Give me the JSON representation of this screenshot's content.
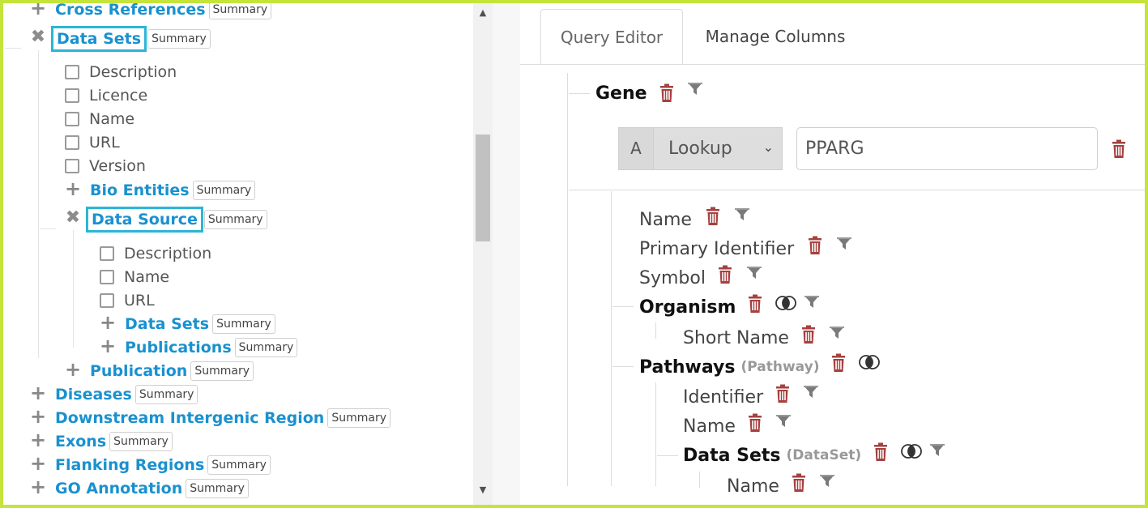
{
  "left_tree": {
    "summary_label": "Summary",
    "items": [
      {
        "label": "Cross References"
      },
      {
        "label": "Data Sets"
      },
      {
        "label": "Description"
      },
      {
        "label": "Licence"
      },
      {
        "label": "Name"
      },
      {
        "label": "URL"
      },
      {
        "label": "Version"
      },
      {
        "label": "Bio Entities"
      },
      {
        "label": "Data Source"
      },
      {
        "label": "Description"
      },
      {
        "label": "Name"
      },
      {
        "label": "URL"
      },
      {
        "label": "Data Sets"
      },
      {
        "label": "Publications"
      },
      {
        "label": "Publication"
      },
      {
        "label": "Diseases"
      },
      {
        "label": "Downstream Intergenic Region"
      },
      {
        "label": "Exons"
      },
      {
        "label": "Flanking Regions"
      },
      {
        "label": "GO Annotation"
      }
    ],
    "icons": {
      "expand": "plus-icon",
      "collapse": "close-icon",
      "checkbox": "checkbox-icon"
    }
  },
  "tabs": [
    {
      "label": "Query Editor",
      "active": true
    },
    {
      "label": "Manage Columns",
      "active": false
    }
  ],
  "query": {
    "root": "Gene",
    "constraint": {
      "code": "A",
      "operator": "Lookup",
      "value": "PPARG"
    },
    "fields": [
      {
        "label": "Name"
      },
      {
        "label": "Primary Identifier"
      },
      {
        "label": "Symbol"
      },
      {
        "label": "Organism"
      },
      {
        "label": "Short Name"
      },
      {
        "label": "Pathways",
        "type": "(Pathway)"
      },
      {
        "label": "Identifier"
      },
      {
        "label": "Name"
      },
      {
        "label": "Data Sets",
        "type": "(DataSet)"
      },
      {
        "label": "Name"
      }
    ]
  },
  "colors": {
    "accent": "#1a91cf",
    "highlight_box": "#2cb5d6",
    "frame": "#c5e43b",
    "trash": "#a5413f"
  }
}
